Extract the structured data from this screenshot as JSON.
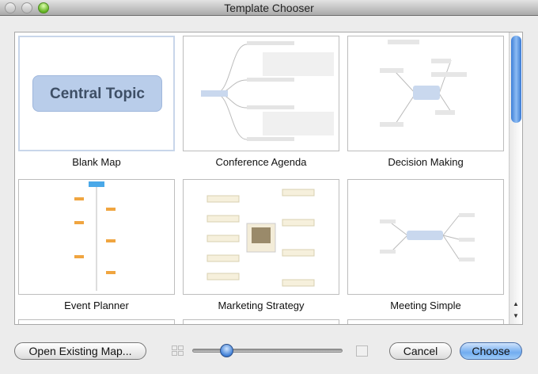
{
  "window": {
    "title": "Template Chooser"
  },
  "templates": [
    {
      "label": "Blank Map",
      "center": "Central Topic",
      "selected": true
    },
    {
      "label": "Conference Agenda",
      "selected": false
    },
    {
      "label": "Decision Making",
      "selected": false
    },
    {
      "label": "Event Planner",
      "selected": false
    },
    {
      "label": "Marketing Strategy",
      "selected": false
    },
    {
      "label": "Meeting Simple",
      "selected": false
    }
  ],
  "zoom_slider": {
    "value": 0.23
  },
  "buttons": {
    "open": "Open Existing Map...",
    "cancel": "Cancel",
    "choose": "Choose"
  },
  "colors": {
    "accent": "#5c9ded",
    "topic": "#b9cdea"
  }
}
